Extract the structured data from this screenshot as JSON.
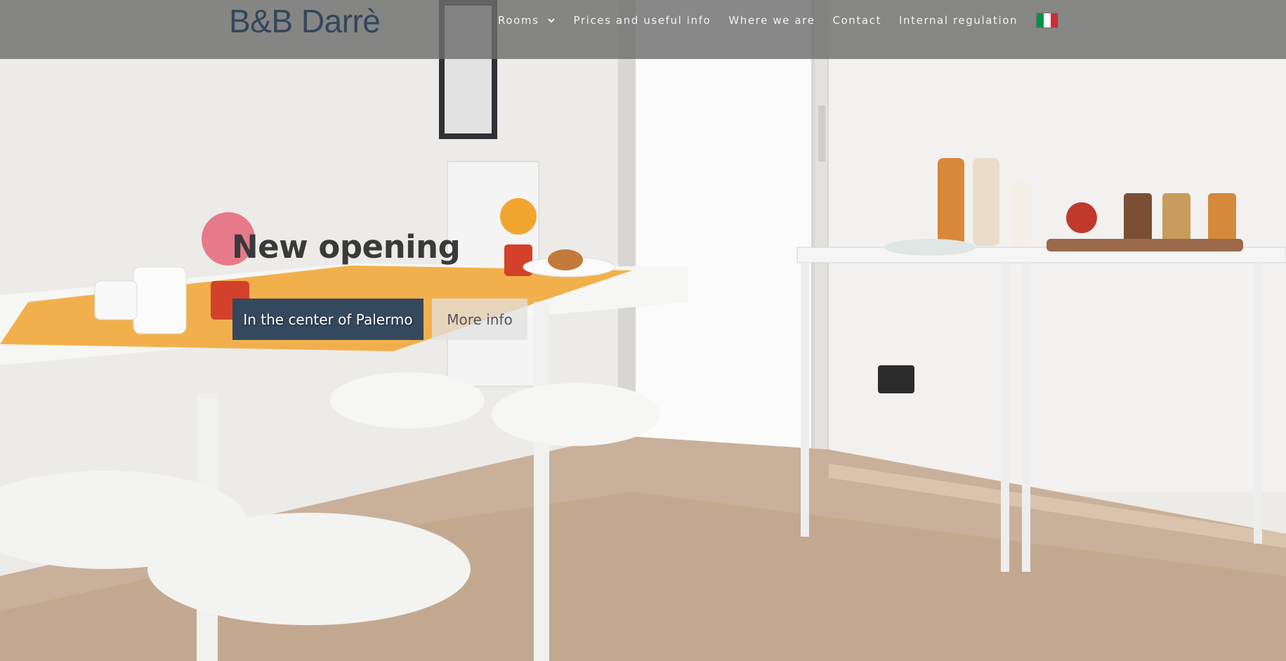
{
  "brand": {
    "name": "B&B Darrè",
    "color": "#33475b"
  },
  "nav": {
    "items": [
      {
        "label": "Rooms",
        "has_dropdown": true
      },
      {
        "label": "Prices and useful info"
      },
      {
        "label": "Where we are"
      },
      {
        "label": "Contact"
      },
      {
        "label": "Internal regulation"
      }
    ],
    "language_flag": "italian-flag-icon",
    "flag_colors": [
      "#009246",
      "#ffffff",
      "#ce2b37"
    ]
  },
  "hero": {
    "title": "New opening",
    "primary_button": "In the center of Palermo",
    "secondary_button": "More info",
    "primary_color": "#34495e"
  }
}
